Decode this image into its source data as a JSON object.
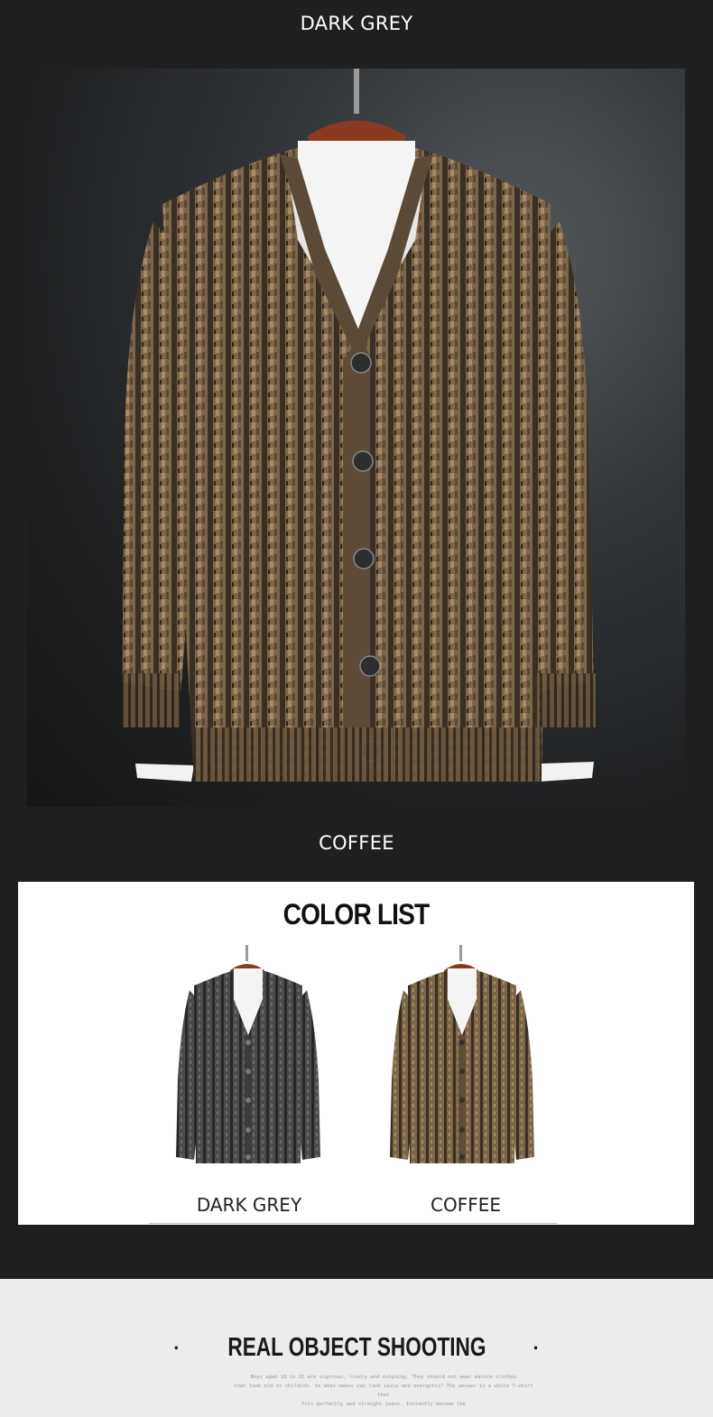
{
  "captions": {
    "top": "DARK GREY",
    "middle": "COFFEE"
  },
  "color_list": {
    "title": "COLOR LIST",
    "items": [
      {
        "label": "DARK GREY",
        "color": "#3e3f40"
      },
      {
        "label": "COFFEE",
        "color": "#7a6448"
      }
    ]
  },
  "footer": {
    "title": "REAL OBJECT SHOOTING",
    "bullet": "·",
    "body_lines": [
      "Boys aged 18 to 25 are vigorous, lively and outgoing. They should not wear mature clothes",
      "that look old or childish. So what makes you look sassy and energetic? The answer is a white T-shirt that",
      "fits perfectly and straight jeans. Instantly become the"
    ]
  },
  "colors": {
    "page_bg": "#1f1f1f",
    "knit_coffee": "#7a6448",
    "knit_grey": "#3e3f40",
    "hanger": "#8b3a22",
    "footer_bg": "#ececec"
  }
}
